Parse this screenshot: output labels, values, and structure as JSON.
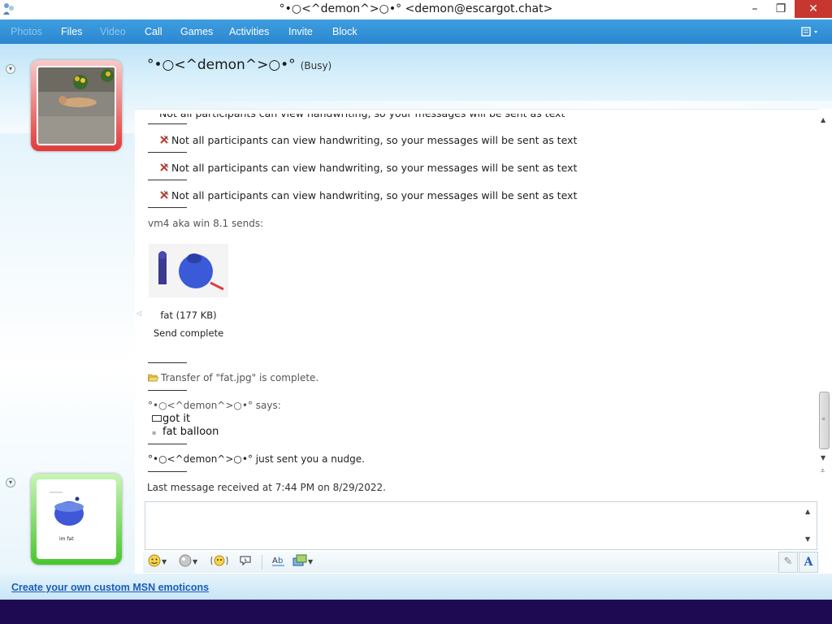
{
  "window": {
    "title": "°•○<^demon^>○•° <demon@escargot.chat>",
    "minimize": "–",
    "maximize": "❐",
    "close": "✕"
  },
  "menu": {
    "items": [
      {
        "label": "Photos",
        "enabled": false
      },
      {
        "label": "Files",
        "enabled": true
      },
      {
        "label": "Video",
        "enabled": false
      },
      {
        "label": "Call",
        "enabled": true
      },
      {
        "label": "Games",
        "enabled": true
      },
      {
        "label": "Activities",
        "enabled": true
      },
      {
        "label": "Invite",
        "enabled": true
      },
      {
        "label": "Block",
        "enabled": true
      }
    ],
    "options_icon": "menu-options-icon"
  },
  "contact": {
    "name": "°•○<^demon^>○•°",
    "status": "(Busy)"
  },
  "conversation": {
    "system_messages": [
      "Not all participants can view handwriting, so your messages will be sent as text",
      "Not all participants can view handwriting, so your messages will be sent as text",
      "Not all participants can view handwriting, so your messages will be sent as text",
      "Not all participants can view handwriting, so your messages will be sent as text"
    ],
    "sender_line": "vm4 aka win 8.1 sends:",
    "file": {
      "name": "fat (177 KB)",
      "status": "Send complete"
    },
    "transfer_notice": "Transfer of \"fat.jpg\" is complete.",
    "says_line": "°•○<^demon^>○•° says:",
    "messages": [
      "got it",
      "fat balloon"
    ],
    "nudge": "°•○<^demon^>○•° just sent you a nudge.",
    "last_received": "Last message received at 7:44 PM on 8/29/2022."
  },
  "user_picture": {
    "caption": "im fat"
  },
  "footer": {
    "custom_emoticons_link": "Create your own custom MSN emoticons"
  },
  "colors": {
    "menubar": "#2b86cf",
    "contact_frame_busy": "#e13a3a",
    "user_frame_online": "#47c72c",
    "taskbar": "#1d0a52",
    "link": "#1c5cb8"
  }
}
